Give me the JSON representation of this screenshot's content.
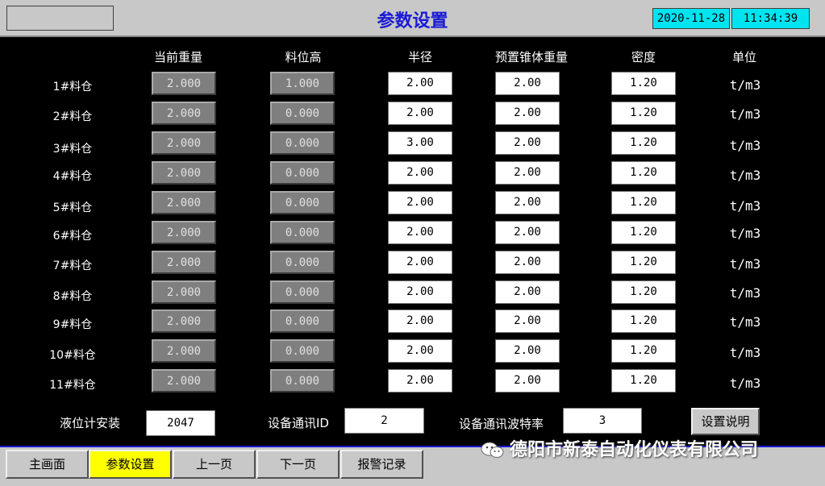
{
  "header": {
    "title": "参数设置",
    "date": "2020-11-28",
    "time": "11:34:39"
  },
  "columns": [
    "当前重量",
    "料位高",
    "半径",
    "预置锥体重量",
    "密度",
    "单位"
  ],
  "rows": [
    {
      "label": "1#料仓",
      "weight": "2.000",
      "level": "1.000",
      "radius": "2.00",
      "cone": "2.00",
      "density": "1.20",
      "unit": "t/m3"
    },
    {
      "label": "2#料仓",
      "weight": "2.000",
      "level": "0.000",
      "radius": "2.00",
      "cone": "2.00",
      "density": "1.20",
      "unit": "t/m3"
    },
    {
      "label": "3#料仓",
      "weight": "2.000",
      "level": "0.000",
      "radius": "3.00",
      "cone": "2.00",
      "density": "1.20",
      "unit": "t/m3"
    },
    {
      "label": "4#料仓",
      "weight": "2.000",
      "level": "0.000",
      "radius": "2.00",
      "cone": "2.00",
      "density": "1.20",
      "unit": "t/m3"
    },
    {
      "label": "5#料仓",
      "weight": "2.000",
      "level": "0.000",
      "radius": "2.00",
      "cone": "2.00",
      "density": "1.20",
      "unit": "t/m3"
    },
    {
      "label": "6#料仓",
      "weight": "2.000",
      "level": "0.000",
      "radius": "2.00",
      "cone": "2.00",
      "density": "1.20",
      "unit": "t/m3"
    },
    {
      "label": "7#料仓",
      "weight": "2.000",
      "level": "0.000",
      "radius": "2.00",
      "cone": "2.00",
      "density": "1.20",
      "unit": "t/m3"
    },
    {
      "label": "8#料仓",
      "weight": "2.000",
      "level": "0.000",
      "radius": "2.00",
      "cone": "2.00",
      "density": "1.20",
      "unit": "t/m3"
    },
    {
      "label": "9#料仓",
      "weight": "2.000",
      "level": "0.000",
      "radius": "2.00",
      "cone": "2.00",
      "density": "1.20",
      "unit": "t/m3"
    },
    {
      "label": "10#料仓",
      "weight": "2.000",
      "level": "0.000",
      "radius": "2.00",
      "cone": "2.00",
      "density": "1.20",
      "unit": "t/m3"
    },
    {
      "label": "11#料仓",
      "weight": "2.000",
      "level": "0.000",
      "radius": "2.00",
      "cone": "2.00",
      "density": "1.20",
      "unit": "t/m3"
    }
  ],
  "settings": {
    "level_gauge_label": "液位计安装",
    "level_gauge_value": "2047",
    "comm_id_label": "设备通讯ID",
    "comm_id_value": "2",
    "baud_label": "设备通讯波特率",
    "baud_value": "3",
    "help_button": "设置说明"
  },
  "nav": [
    {
      "label": "主画面",
      "active": false
    },
    {
      "label": "参数设置",
      "active": true
    },
    {
      "label": "上一页",
      "active": false
    },
    {
      "label": "下一页",
      "active": false
    },
    {
      "label": "报警记录",
      "active": false
    }
  ],
  "watermark": "德阳市新泰自动化仪表有限公司",
  "colors": {
    "title": "#1a1ad6",
    "datetime_bg": "#00e4f0",
    "active_nav": "#ffff00"
  }
}
